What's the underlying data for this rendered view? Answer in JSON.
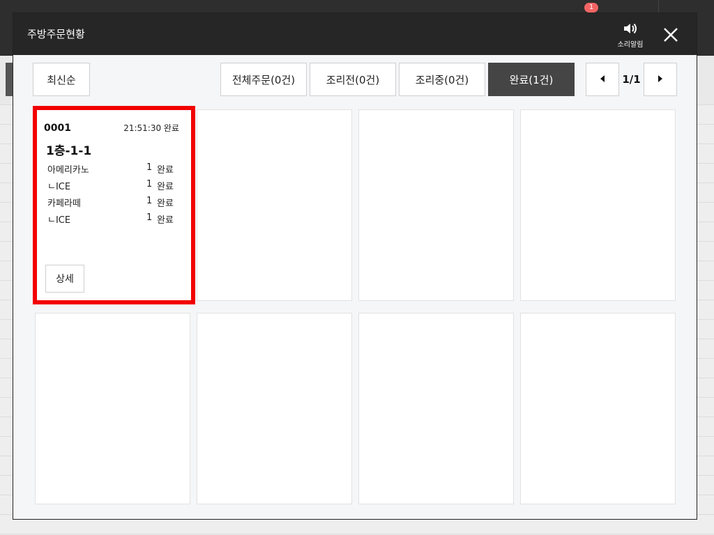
{
  "background": {
    "notification_badge": "1"
  },
  "modal": {
    "title": "주방주문현황",
    "sound_label": "소리알림",
    "toolbar": {
      "sort_label": "최신순",
      "tabs": [
        {
          "label": "전체주문(0건)",
          "active": false
        },
        {
          "label": "조리전(0건)",
          "active": false
        },
        {
          "label": "조리중(0건)",
          "active": false
        },
        {
          "label": "완료(1건)",
          "active": true
        }
      ],
      "page_indicator": "1/1"
    },
    "orders": [
      {
        "number": "0001",
        "time_status": "21:51:30 완료",
        "table": "1층-1-1",
        "items": [
          {
            "name": "아메리카노",
            "qty": "1",
            "status": "완료"
          },
          {
            "name": "ㄴICE",
            "qty": "1",
            "status": "완료"
          },
          {
            "name": "카페라떼",
            "qty": "1",
            "status": "완료"
          },
          {
            "name": "ㄴICE",
            "qty": "1",
            "status": "완료"
          }
        ],
        "detail_label": "상세"
      }
    ]
  },
  "colors": {
    "header_bg": "#262626",
    "active_tab_bg": "#454545",
    "highlight_border": "#f20000",
    "badge": "#f26464"
  }
}
